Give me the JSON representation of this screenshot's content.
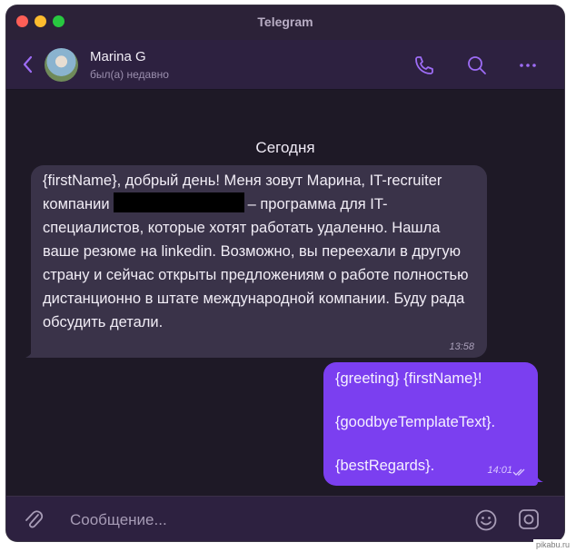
{
  "window": {
    "title": "Telegram"
  },
  "header": {
    "contact_name": "Marina G",
    "status": "был(а) недавно",
    "icons": [
      "back-icon",
      "phone-icon",
      "search-icon",
      "more-icon"
    ]
  },
  "chat": {
    "date_divider": "Сегодня",
    "messages": [
      {
        "direction": "incoming",
        "text_before_redaction": "{firstName}, добрый день! Меня зовут Марина, IT-recruiter компании",
        "text_after_redaction": "– программа для IT-специалистов, которые хотят работать удаленно. Нашла ваше резюме на linkedin. Возможно, вы переехали в другую страну и сейчас открыты предложениям о работе полностью дистанционно в штате международной компании. Буду рада обсудить детали.",
        "time": "13:58"
      },
      {
        "direction": "outgoing",
        "text": "{greeting} {firstName}!\n\n{goodbyeTemplateText}.\n\n{bestRegards}.",
        "time": "14:01"
      }
    ]
  },
  "input": {
    "placeholder": "Сообщение...",
    "icons": [
      "paperclip-icon",
      "emoji-icon",
      "camera-icon"
    ]
  },
  "watermark": "pikabu.ru",
  "colors": {
    "accent": "#7b3ff0",
    "background": "#1e1926",
    "header": "#2d2140",
    "incoming_bubble": "#3a3349"
  }
}
